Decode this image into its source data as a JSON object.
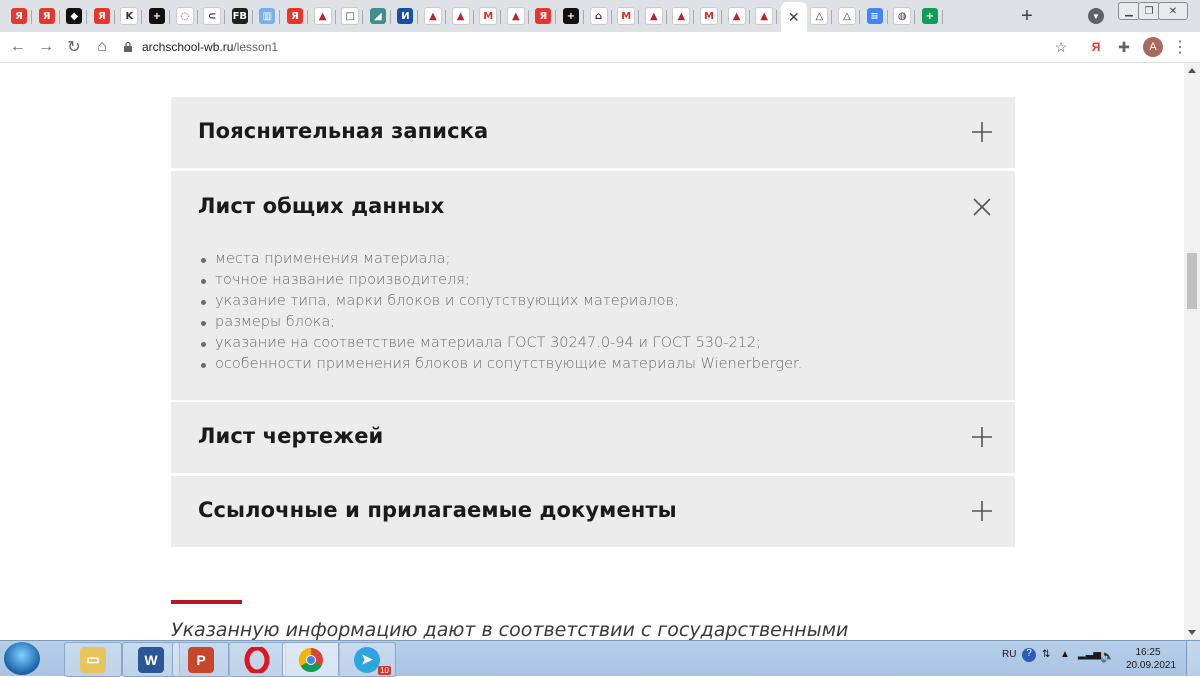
{
  "browser": {
    "tabs": [
      {
        "icon": "yandex-icon",
        "color": "#e7372d",
        "glyph": "Я"
      },
      {
        "icon": "yandex-icon",
        "color": "#e7372d",
        "glyph": "Я"
      },
      {
        "icon": "diamond-icon",
        "color": "#111111",
        "glyph": "◆"
      },
      {
        "icon": "yandex-icon",
        "color": "#e7372d",
        "glyph": "Я"
      },
      {
        "icon": "k-icon",
        "color": "#ffffff",
        "glyph": "K"
      },
      {
        "icon": "plus-circle-icon",
        "color": "#111111",
        "glyph": "+"
      },
      {
        "icon": "green-yellow-icon",
        "color": "#ffffff",
        "glyph": "◌"
      },
      {
        "icon": "link-icon",
        "color": "#ffffff",
        "glyph": "⊂"
      },
      {
        "icon": "fb-icon",
        "color": "#222222",
        "glyph": "FB"
      },
      {
        "icon": "calendar-icon",
        "color": "#7ab0e8",
        "glyph": "▥"
      },
      {
        "icon": "yandex-icon",
        "color": "#e7372d",
        "glyph": "Я"
      },
      {
        "icon": "wienerberger-icon",
        "color": "#ffffff",
        "glyph": "▲"
      },
      {
        "icon": "square-green-icon",
        "color": "#ffffff",
        "glyph": "□"
      },
      {
        "icon": "teal-icon",
        "color": "#3e8e8e",
        "glyph": "◢"
      },
      {
        "icon": "i-icon",
        "color": "#1b4fa0",
        "glyph": "И"
      },
      {
        "icon": "wienerberger-icon",
        "color": "#ffffff",
        "glyph": "▲"
      },
      {
        "icon": "wienerberger-icon",
        "color": "#ffffff",
        "glyph": "▲"
      },
      {
        "icon": "gmail-icon",
        "color": "#ffffff",
        "glyph": "M"
      },
      {
        "icon": "wienerberger-icon",
        "color": "#ffffff",
        "glyph": "▲"
      },
      {
        "icon": "yandex-icon",
        "color": "#e7372d",
        "glyph": "Я"
      },
      {
        "icon": "plus-circle-icon",
        "color": "#111111",
        "glyph": "+"
      },
      {
        "icon": "house-icon",
        "color": "#ffffff",
        "glyph": "⌂"
      },
      {
        "icon": "gmail-icon",
        "color": "#ffffff",
        "glyph": "M"
      },
      {
        "icon": "wienerberger-icon",
        "color": "#ffffff",
        "glyph": "▲"
      },
      {
        "icon": "wienerberger-icon",
        "color": "#ffffff",
        "glyph": "▲"
      },
      {
        "icon": "gmail-icon",
        "color": "#ffffff",
        "glyph": "M"
      },
      {
        "icon": "wienerberger-icon",
        "color": "#ffffff",
        "glyph": "▲"
      },
      {
        "icon": "wienerberger-icon",
        "color": "#ffffff",
        "glyph": "▲"
      }
    ],
    "active_tab_close": "✕",
    "tabs_after": [
      {
        "icon": "google-drive-icon",
        "color": "#ffffff",
        "glyph": "△"
      },
      {
        "icon": "google-drive-icon",
        "color": "#ffffff",
        "glyph": "△"
      },
      {
        "icon": "google-docs-icon",
        "color": "#4285f4",
        "glyph": "≡"
      },
      {
        "icon": "lightbulb-icon",
        "color": "#ffffff",
        "glyph": "◍"
      },
      {
        "icon": "google-sheets-plus-icon",
        "color": "#0f9d58",
        "glyph": "+"
      }
    ],
    "new_tab": "+",
    "url_host": "archschool-wb.ru",
    "url_path": "/lesson1",
    "avatar_letter": "A",
    "yandex_ext": "Я"
  },
  "accordion": {
    "items": [
      {
        "title": "Пояснительная записка",
        "state": "collapsed"
      },
      {
        "title": "Лист общих данных",
        "state": "expanded",
        "bullets": [
          "места применения материала;",
          "точное название производителя;",
          "указание типа, марки блоков и сопутствующих материалов;",
          "размеры блока;",
          "указание на соответствие материала ГОСТ 30247.0-94 и ГОСТ 530-212;",
          "особенности применения блоков и сопутствующие материалы Wienerberger."
        ]
      },
      {
        "title": "Лист чертежей",
        "state": "collapsed"
      },
      {
        "title": "Ссылочные и прилагаемые документы",
        "state": "collapsed"
      }
    ]
  },
  "bottom_text": "Указанную информацию дают в соответствии с государственными",
  "accent_color": "#b01822",
  "taskbar": {
    "lang": "RU",
    "time": "16:25",
    "date": "20.09.2021",
    "telegram_badge": "10"
  }
}
